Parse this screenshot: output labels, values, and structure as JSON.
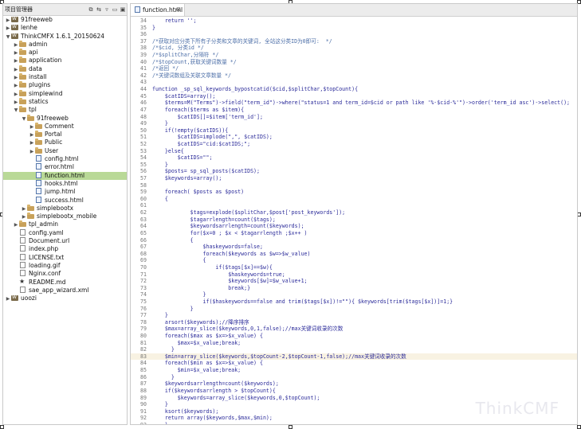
{
  "left_panel": {
    "title": "项目管理器",
    "toolbar": [
      "⧉",
      "⇆",
      "▿",
      "▭",
      "▣"
    ],
    "tree": [
      {
        "depth": 0,
        "twisty": "closed",
        "icon": "project",
        "label": "91freeweb"
      },
      {
        "depth": 0,
        "twisty": "closed",
        "icon": "project",
        "label": "lenhe"
      },
      {
        "depth": 0,
        "twisty": "open",
        "icon": "project",
        "label": "ThinkCMFX 1.6.1_20150624"
      },
      {
        "depth": 1,
        "twisty": "closed",
        "icon": "folder",
        "label": "admin"
      },
      {
        "depth": 1,
        "twisty": "closed",
        "icon": "folder",
        "label": "api"
      },
      {
        "depth": 1,
        "twisty": "closed",
        "icon": "folder",
        "label": "application"
      },
      {
        "depth": 1,
        "twisty": "closed",
        "icon": "folder",
        "label": "data"
      },
      {
        "depth": 1,
        "twisty": "closed",
        "icon": "folder",
        "label": "install"
      },
      {
        "depth": 1,
        "twisty": "closed",
        "icon": "folder",
        "label": "plugins"
      },
      {
        "depth": 1,
        "twisty": "closed",
        "icon": "folder",
        "label": "simplewind"
      },
      {
        "depth": 1,
        "twisty": "closed",
        "icon": "folder",
        "label": "statics"
      },
      {
        "depth": 1,
        "twisty": "open",
        "icon": "folder",
        "label": "tpl"
      },
      {
        "depth": 2,
        "twisty": "open",
        "icon": "folder",
        "label": "91freeweb"
      },
      {
        "depth": 3,
        "twisty": "closed",
        "icon": "folder",
        "label": "Comment"
      },
      {
        "depth": 3,
        "twisty": "closed",
        "icon": "folder",
        "label": "Portal"
      },
      {
        "depth": 3,
        "twisty": "closed",
        "icon": "folder",
        "label": "Public"
      },
      {
        "depth": 3,
        "twisty": "closed",
        "icon": "folder",
        "label": "User"
      },
      {
        "depth": 3,
        "twisty": "none",
        "icon": "html",
        "label": "config.html"
      },
      {
        "depth": 3,
        "twisty": "none",
        "icon": "html",
        "label": "error.html"
      },
      {
        "depth": 3,
        "twisty": "none",
        "icon": "html",
        "label": "function.html",
        "selected": true
      },
      {
        "depth": 3,
        "twisty": "none",
        "icon": "html",
        "label": "hooks.html"
      },
      {
        "depth": 3,
        "twisty": "none",
        "icon": "html",
        "label": "jump.html"
      },
      {
        "depth": 3,
        "twisty": "none",
        "icon": "html",
        "label": "success.html"
      },
      {
        "depth": 2,
        "twisty": "closed",
        "icon": "folder",
        "label": "simplebootx"
      },
      {
        "depth": 2,
        "twisty": "closed",
        "icon": "folder",
        "label": "simplebootx_mobile"
      },
      {
        "depth": 1,
        "twisty": "closed",
        "icon": "folder",
        "label": "tpl_admin"
      },
      {
        "depth": 1,
        "twisty": "none",
        "icon": "file",
        "label": "config.yaml"
      },
      {
        "depth": 1,
        "twisty": "none",
        "icon": "file",
        "label": "Document.url"
      },
      {
        "depth": 1,
        "twisty": "none",
        "icon": "file",
        "label": "index.php"
      },
      {
        "depth": 1,
        "twisty": "none",
        "icon": "file",
        "label": "LICENSE.txt"
      },
      {
        "depth": 1,
        "twisty": "none",
        "icon": "file",
        "label": "loading.gif"
      },
      {
        "depth": 1,
        "twisty": "none",
        "icon": "file",
        "label": "Nginx.conf"
      },
      {
        "depth": 1,
        "twisty": "none",
        "icon": "star",
        "label": "README.md"
      },
      {
        "depth": 1,
        "twisty": "none",
        "icon": "file",
        "label": "sae_app_wizard.xml"
      },
      {
        "depth": 0,
        "twisty": "closed",
        "icon": "project",
        "label": "uoozi"
      }
    ]
  },
  "editor": {
    "tab_label": "function.html",
    "tab_close": "⊠",
    "watermark": "ThinkCMF",
    "lines": [
      {
        "n": "34",
        "t": "    return '';"
      },
      {
        "n": "35",
        "t": "}"
      },
      {
        "n": "36",
        "t": ""
      },
      {
        "n": "37",
        "t": "/*获取对应分类下所有子分类和文章的关键词, 全站这分类ID为0即可:  */",
        "c": true
      },
      {
        "n": "38",
        "t": "/*$cid, 分类id */",
        "c": true
      },
      {
        "n": "39",
        "t": "/*$splitChar,分隔符 */",
        "c": true
      },
      {
        "n": "40",
        "t": "/*$topCount,获取关键词数量 */",
        "c": true
      },
      {
        "n": "41",
        "t": "/*返回 */",
        "c": true
      },
      {
        "n": "42",
        "t": "/*关键词数组及关联文章数量 */",
        "c": true
      },
      {
        "n": "43",
        "t": ""
      },
      {
        "n": "44",
        "t": "function _sp_sql_keywords_bypostcatid($cid,$splitChar,$topCount){"
      },
      {
        "n": "45",
        "t": "    $catIDS=array();"
      },
      {
        "n": "46",
        "t": "    $terms=M(\"Terms\")->field(\"term_id\")->where(\"status=1 and term_id=$cid or path like '%-$cid-%'\")->order('term_id asc')->select();"
      },
      {
        "n": "47",
        "t": "    foreach($terms as $item){"
      },
      {
        "n": "48",
        "t": "        $catIDS[]=$item['term_id'];"
      },
      {
        "n": "49",
        "t": "    }"
      },
      {
        "n": "50",
        "t": "    if(!empty($catIDS)){"
      },
      {
        "n": "51",
        "t": "        $catIDS=implode(\",\", $catIDS);"
      },
      {
        "n": "52",
        "t": "        $catIDS=\"cid:$catIDS;\";"
      },
      {
        "n": "53",
        "t": "    }else{"
      },
      {
        "n": "54",
        "t": "        $catIDS=\"\";"
      },
      {
        "n": "55",
        "t": "    }"
      },
      {
        "n": "56",
        "t": "    $posts= sp_sql_posts($catIDS);"
      },
      {
        "n": "57",
        "t": "    $keywords=array();"
      },
      {
        "n": "58",
        "t": ""
      },
      {
        "n": "59",
        "t": "    foreach( $posts as $post)"
      },
      {
        "n": "60",
        "t": "    {"
      },
      {
        "n": "61",
        "t": ""
      },
      {
        "n": "62",
        "t": "            $tags=explode($splitChar,$post['post_keywords']);"
      },
      {
        "n": "63",
        "t": "            $tagarrlength=count($tags);"
      },
      {
        "n": "64",
        "t": "            $keywordsarrlength=count($keywords);"
      },
      {
        "n": "65",
        "t": "            for($x=0 ; $x < $tagarrlength ;$x++ )"
      },
      {
        "n": "66",
        "t": "            {"
      },
      {
        "n": "67",
        "t": "                $haskeywords=false;"
      },
      {
        "n": "68",
        "t": "                foreach($keywords as $w=>$w_value)"
      },
      {
        "n": "69",
        "t": "                {"
      },
      {
        "n": "70",
        "t": "                    if($tags[$x]==$w){"
      },
      {
        "n": "71",
        "t": "                        $haskeywords=true;"
      },
      {
        "n": "72",
        "t": "                        $keywords[$w]=$w_value+1;"
      },
      {
        "n": "73",
        "t": "                        break;}"
      },
      {
        "n": "74",
        "t": "                }"
      },
      {
        "n": "75",
        "t": "                if($haskeywords==false and trim($tags[$x])!=\"\"){ $keywords[trim($tags[$x])]=1;}"
      },
      {
        "n": "76",
        "t": "            }"
      },
      {
        "n": "77",
        "t": "    }"
      },
      {
        "n": "78",
        "t": "    arsort($keywords);//降序排序"
      },
      {
        "n": "79",
        "t": "    $max=array_slice($keywords,0,1,false);//max关键词收录的次数"
      },
      {
        "n": "80",
        "t": "    foreach($max as $x=>$x_value) {"
      },
      {
        "n": "81",
        "t": "        $max=$x_value;break;"
      },
      {
        "n": "82",
        "t": "      }"
      },
      {
        "n": "83",
        "t": "    $min=array_slice($keywords,$topCount-2,$topCount-1,false);//max关键词收录的次数",
        "hl": true
      },
      {
        "n": "84",
        "t": "    foreach($min as $x=>$x_value) {"
      },
      {
        "n": "85",
        "t": "        $min=$x_value;break;"
      },
      {
        "n": "86",
        "t": "      }"
      },
      {
        "n": "87",
        "t": "    $keywordsarrlength=count($keywords);"
      },
      {
        "n": "88",
        "t": "    if($keywordsarrlength > $topCount){"
      },
      {
        "n": "89",
        "t": "        $keywords=array_slice($keywords,0,$topCount);"
      },
      {
        "n": "90",
        "t": "    }"
      },
      {
        "n": "91",
        "t": "    ksort($keywords);"
      },
      {
        "n": "92",
        "t": "    return array($keywords,$max,$min);"
      },
      {
        "n": "93",
        "t": "    }"
      }
    ]
  }
}
